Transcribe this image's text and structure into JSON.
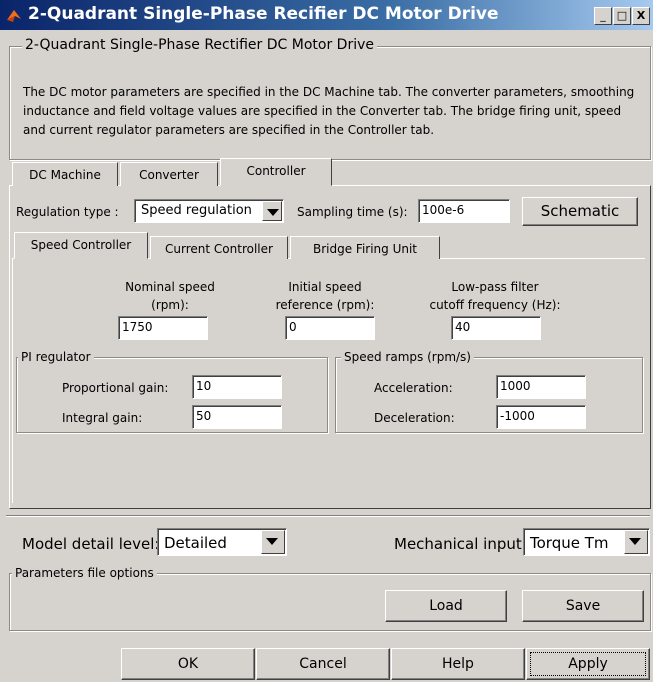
{
  "window": {
    "title": "2-Quadrant Single-Phase Recifier DC Motor Drive",
    "min": "_",
    "max": "□",
    "close": "X"
  },
  "description": {
    "group_label": "2-Quadrant Single-Phase Rectifier DC Motor Drive",
    "text": "The DC motor parameters are specified in the DC Machine tab. The converter parameters, smoothing inductance and field voltage values are specified in the Converter tab. The bridge firing unit, speed and current regulator parameters are specified in the Controller tab."
  },
  "main_tabs": [
    "DC Machine",
    "Converter",
    "Controller"
  ],
  "controller": {
    "regulation_label": "Regulation type :",
    "regulation_value": "Speed regulation",
    "sampling_label": "Sampling time (s):",
    "sampling_value": "100e-6",
    "schematic": "Schematic"
  },
  "sub_tabs": [
    "Speed Controller",
    "Current Controller",
    "Bridge Firing Unit"
  ],
  "speed": {
    "nominal_label1": "Nominal speed",
    "nominal_label2": "(rpm):",
    "nominal_value": "1750",
    "initial_label1": "Initial speed",
    "initial_label2": "reference (rpm):",
    "initial_value": "0",
    "lowpass_label1": "Low-pass filter",
    "lowpass_label2": "cutoff frequency (Hz):",
    "lowpass_value": "40"
  },
  "pi": {
    "label": "PI regulator",
    "prop_label": "Proportional gain:",
    "prop_value": "10",
    "int_label": "Integral gain:",
    "int_value": "50"
  },
  "ramps": {
    "label": "Speed ramps (rpm/s)",
    "acc_label": "Acceleration:",
    "acc_value": "1000",
    "dec_label": "Deceleration:",
    "dec_value": "-1000"
  },
  "bottom": {
    "detail_label": "Model detail level:",
    "detail_value": "Detailed",
    "mech_label": "Mechanical input:",
    "mech_value": "Torque Tm",
    "params_label": "Parameters file options",
    "load": "Load",
    "save": "Save"
  },
  "buttons": {
    "ok": "OK",
    "cancel": "Cancel",
    "help": "Help",
    "apply": "Apply"
  }
}
